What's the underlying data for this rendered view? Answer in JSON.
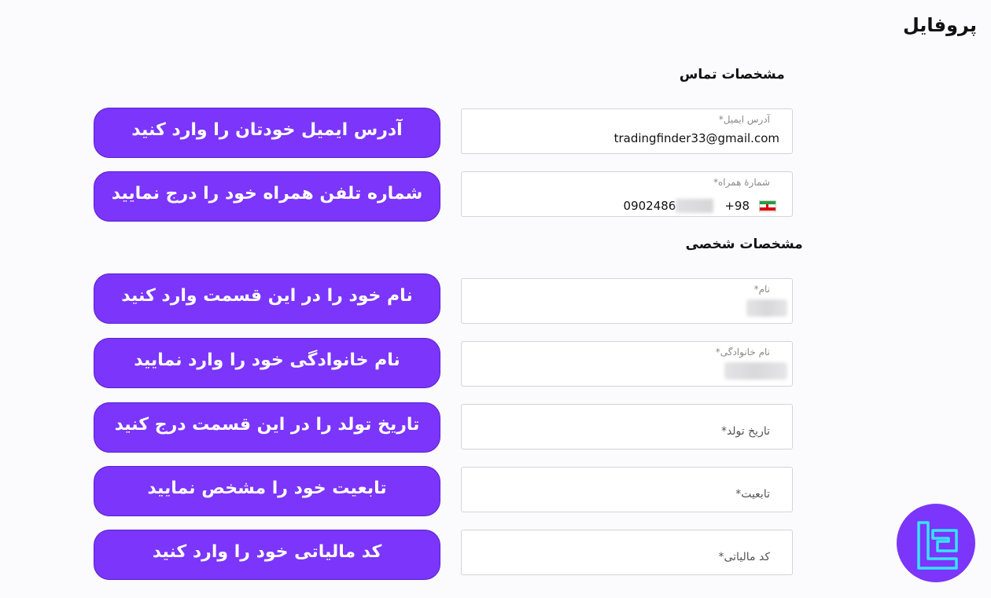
{
  "page": {
    "title": "پروفایل"
  },
  "sections": {
    "contact": "مشخصات تماس",
    "personal": "مشخصات شخصی"
  },
  "fields": {
    "email": {
      "label": "آدرس ایمیل*",
      "value": "tradingfinder33@gmail.com"
    },
    "phone": {
      "label": "شمارهٔ همراه*",
      "country_code": "+98",
      "value": "0902486"
    },
    "first_name": {
      "label": "نام*"
    },
    "last_name": {
      "label": "نام خانوادگی*"
    },
    "birth_date": {
      "label": "تاریخ تولد*"
    },
    "nationality": {
      "label": "تابعیت*"
    },
    "tax_code": {
      "label": "کد مالیاتی*"
    }
  },
  "callouts": {
    "email": "آدرس ایمیل خودتان را وارد کنید",
    "phone": "شماره تلفن همراه خود را درج نمایید",
    "first_name": "نام خود را در این قسمت وارد کنید",
    "last_name": "نام خانوادگی خود را وارد نمایید",
    "birth_date": "تاریخ تولد را در این قسمت درج کنید",
    "nationality": "تابعیت خود را مشخص نمایید",
    "tax_code": "کد مالیاتی خود را وارد کنید"
  },
  "colors": {
    "accent": "#7b35fb",
    "logo_stroke": "#36e3ff"
  },
  "icons": {
    "flag": "iran-flag-icon",
    "logo": "tradingfinder-logo-icon"
  }
}
